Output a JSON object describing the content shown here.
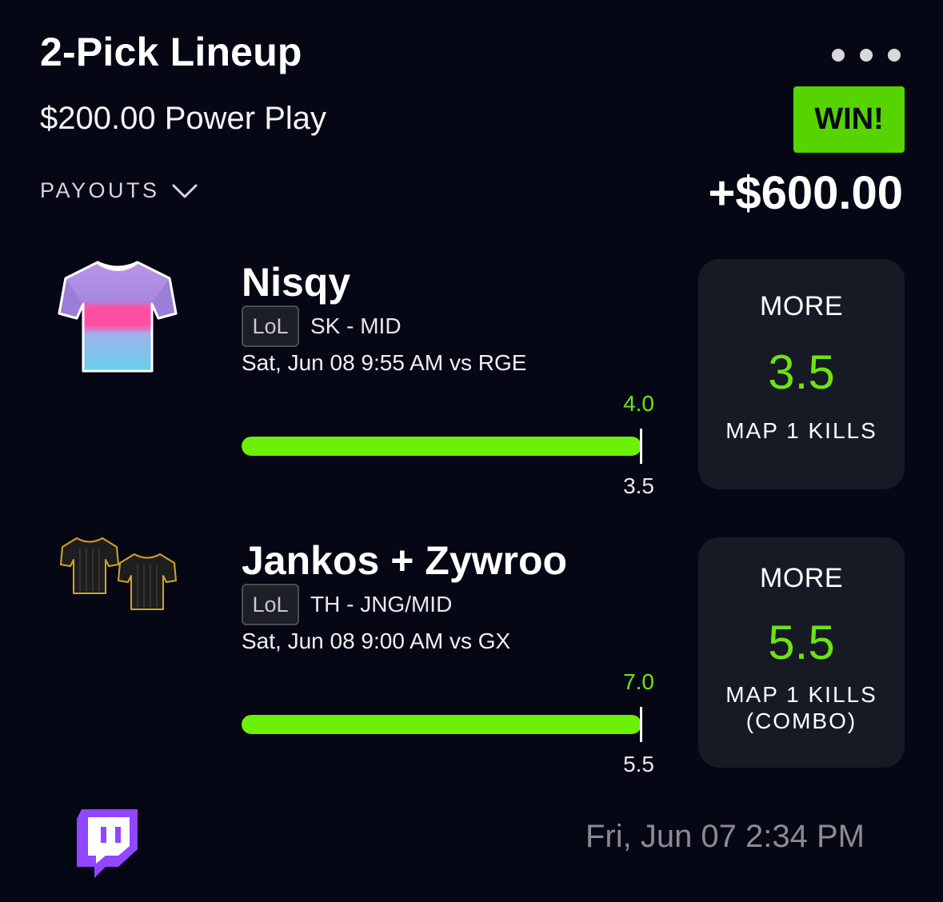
{
  "header": {
    "title": "2-Pick Lineup",
    "subtitle": "$200.00 Power Play",
    "status_badge": "WIN!",
    "winnings": "+$600.00",
    "payouts_label": "PAYOUTS",
    "menu_icon": "more-dots-icon"
  },
  "picks": [
    {
      "player": "Nisqy",
      "league": "LoL",
      "team_position": "SK - MID",
      "game_info": "Sat, Jun 08 9:55 AM  vs RGE",
      "actual_value": "4.0",
      "line_value": "3.5",
      "progress": 1.0,
      "direction": "MORE",
      "line": "3.5",
      "stat": "MAP 1 KILLS",
      "stat_sub": "",
      "jersey_colors": [
        "#b08fe0",
        "#ff4fa3",
        "#7fd0ea"
      ]
    },
    {
      "player": "Jankos + Zywroo",
      "league": "LoL",
      "team_position": "TH - JNG/MID",
      "game_info": "Sat, Jun 08 9:00 AM  vs GX",
      "actual_value": "7.0",
      "line_value": "5.5",
      "progress": 1.0,
      "direction": "MORE",
      "line": "5.5",
      "stat": "MAP 1 KILLS",
      "stat_sub": "(COMBO)",
      "jersey_colors": [
        "#1c1c1c",
        "#d4a32a"
      ]
    }
  ],
  "footer": {
    "timestamp": "Fri, Jun 07 2:34 PM",
    "stream_icon": "twitch-icon"
  },
  "colors": {
    "background": "#050814",
    "accent_green": "#6cf005",
    "win_badge": "#55d400",
    "card_bg": "#161a25",
    "twitch_purple": "#9146ff"
  }
}
